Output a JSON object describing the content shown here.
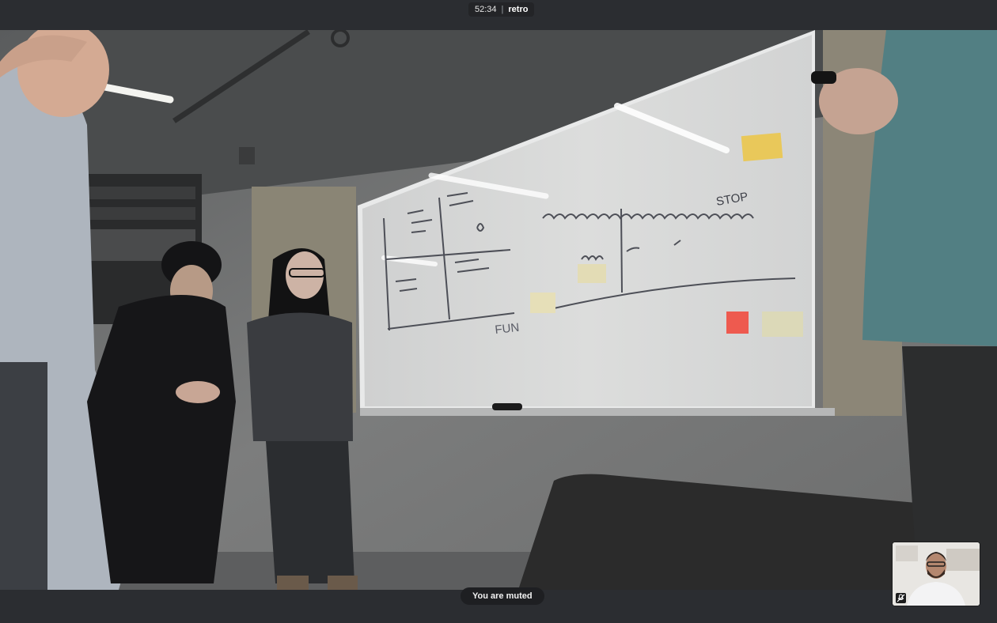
{
  "call": {
    "elapsed": "52:34",
    "separator": "|",
    "room_name": "retro"
  },
  "status": {
    "muted_message": "You are muted"
  },
  "whiteboard": {
    "stop_label": "STOP",
    "fun_label": "FUN"
  },
  "colors": {
    "bar_background": "#2b2d31",
    "toast_background": "#1e1f22",
    "sticky_yellow": "#e9c85a",
    "sticky_pink": "#ee5a4f"
  },
  "icons": {
    "selfview_badge": "microphone-off-icon"
  }
}
